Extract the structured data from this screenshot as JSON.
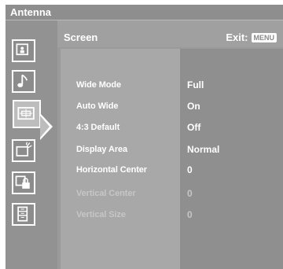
{
  "header": {
    "title": "Antenna"
  },
  "panel": {
    "title": "Screen",
    "exit_label": "Exit:",
    "exit_key": "MENU"
  },
  "sidebar": {
    "items": [
      {
        "name": "picture-icon"
      },
      {
        "name": "music-note-icon"
      },
      {
        "name": "screen-icon",
        "active": true
      },
      {
        "name": "channel-setup-icon"
      },
      {
        "name": "lock-icon"
      },
      {
        "name": "setup-icon"
      }
    ]
  },
  "settings": {
    "rows": [
      {
        "label": "Wide Mode",
        "value": "Full",
        "enabled": true
      },
      {
        "label": "Auto Wide",
        "value": "On",
        "enabled": true
      },
      {
        "label": "4:3 Default",
        "value": "Off",
        "enabled": true
      },
      {
        "label": "Display Area",
        "value": "Normal",
        "enabled": true
      },
      {
        "label": "Horizontal Center",
        "value": "0",
        "enabled": true
      },
      {
        "label": "Vertical Center",
        "value": "0",
        "enabled": false
      },
      {
        "label": "Vertical Size",
        "value": "0",
        "enabled": false
      }
    ]
  },
  "colors": {
    "background": "#9a9a9a",
    "value_column": "#8f8f8f",
    "text": "#ffffff",
    "disabled_text": "#c6c6c6"
  }
}
